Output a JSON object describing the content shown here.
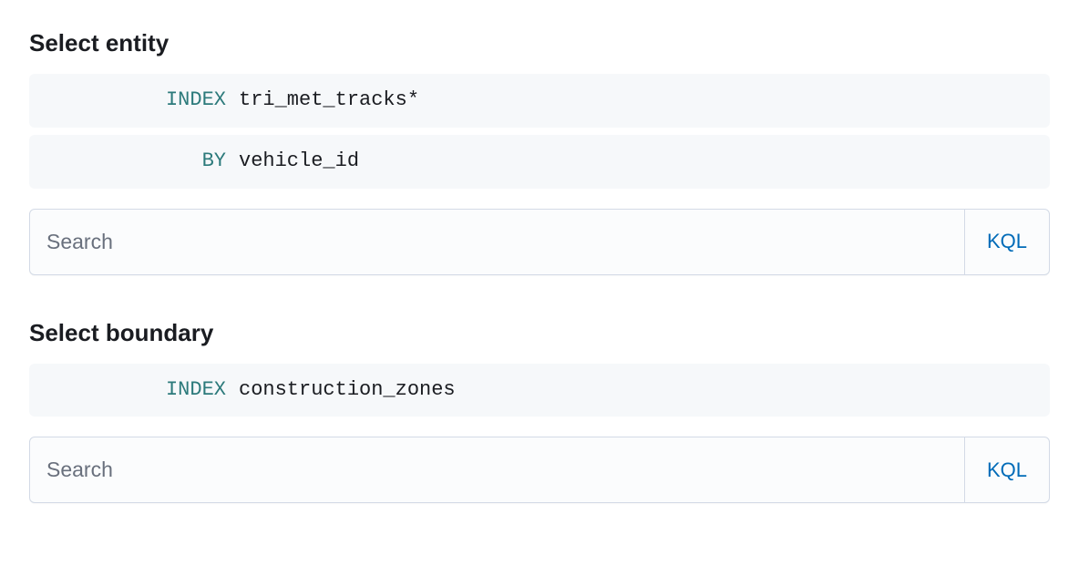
{
  "entity": {
    "title": "Select entity",
    "index_keyword": "INDEX",
    "index_value": "tri_met_tracks*",
    "by_keyword": "BY",
    "by_value": "vehicle_id",
    "search_placeholder": "Search",
    "kql_label": "KQL"
  },
  "boundary": {
    "title": "Select boundary",
    "index_keyword": "INDEX",
    "index_value": "construction_zones",
    "search_placeholder": "Search",
    "kql_label": "KQL"
  }
}
